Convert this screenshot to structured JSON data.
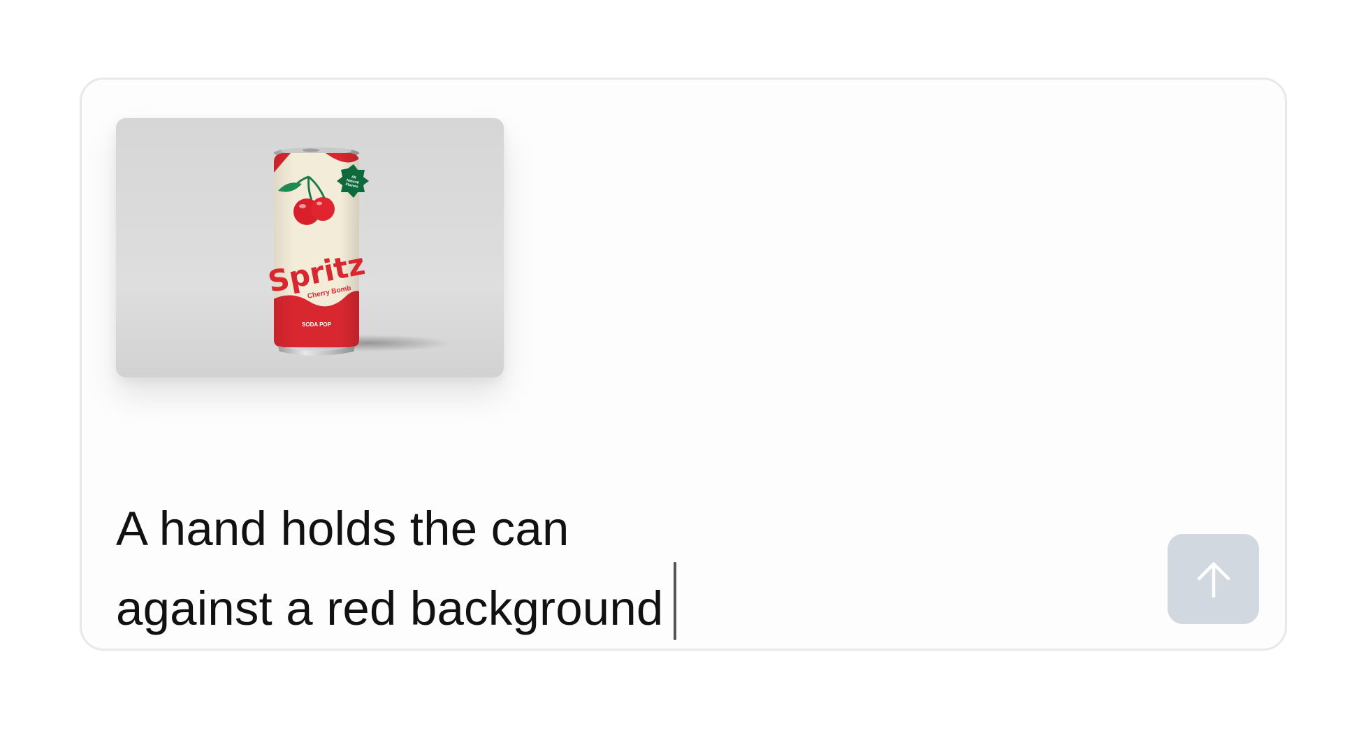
{
  "composer": {
    "prompt_line_1": "A hand holds the can",
    "prompt_line_2": "against a red background",
    "send_icon": "arrow-up-icon"
  },
  "attachment": {
    "brand": "Spritz",
    "flavor": "Cherry Bomb",
    "subtitle": "SODA POP",
    "badge_line_1": "All",
    "badge_line_2": "Natural",
    "badge_line_3": "Flavors"
  },
  "colors": {
    "border": "#e6e8ec",
    "send_button": "#d2d8e0",
    "can_red": "#d8272f",
    "can_cream": "#f3ecd8",
    "badge_green": "#0e6a3d"
  }
}
